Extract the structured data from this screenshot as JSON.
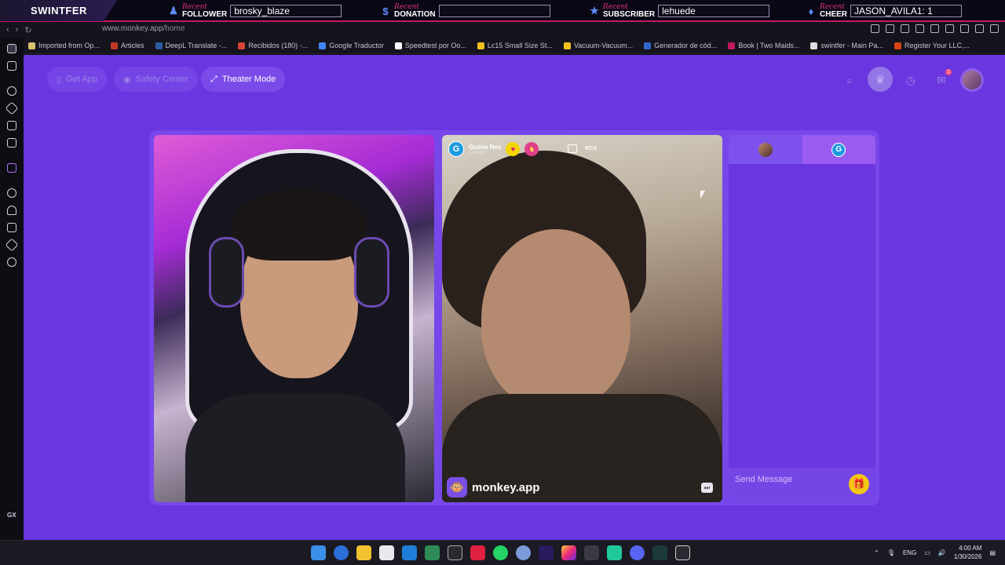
{
  "overlay": {
    "brand": "SWINTFER",
    "recent_label": "Recent",
    "follower": {
      "kind": "FOLLOWER",
      "value": "brosky_blaze",
      "icon": "person-icon"
    },
    "donation": {
      "kind": "DONATION",
      "value": "",
      "icon": "dollar-icon"
    },
    "subscriber": {
      "kind": "SUBSCRIBER",
      "value": "lehuede",
      "icon": "star-icon"
    },
    "cheer": {
      "kind": "CHEER",
      "value": "JASON_AVILA1: 1",
      "icon": "drop-icon"
    }
  },
  "browser": {
    "url_host": "www.monkey.app",
    "url_path": "/home",
    "bookmarks": [
      {
        "label": "Imported from Op...",
        "color": "#d9c06a"
      },
      {
        "label": "Articles",
        "color": "#c0392b"
      },
      {
        "label": "DeepL Translate -...",
        "color": "#2e5c9e"
      },
      {
        "label": "Recibidos (180) -...",
        "color": "#d44638"
      },
      {
        "label": "Google Traductor",
        "color": "#4285f4"
      },
      {
        "label": "Speedtest por Oo...",
        "color": "#ffffff"
      },
      {
        "label": "Lc15 Small Size St...",
        "color": "#f0c020"
      },
      {
        "label": "Vacuum-Vacuum...",
        "color": "#f0c020"
      },
      {
        "label": "Generador de cód...",
        "color": "#3366cc"
      },
      {
        "label": "Book | Two Maids...",
        "color": "#c2185b"
      },
      {
        "label": "swintfer - Main Pa...",
        "color": "#dddddd"
      },
      {
        "label": "Register Your LLC,...",
        "color": "#d84315"
      }
    ],
    "gx_label": "GX"
  },
  "app": {
    "get_app": "Get App",
    "safety_center": "Safety Center",
    "theater_mode": "Theater Mode",
    "peer": {
      "initial": "G",
      "name": "Gueva Nea",
      "location": "Canadá",
      "tag": "RGX"
    },
    "watermark": "monkey.app",
    "chat_tab_b_initial": "G",
    "message_placeholder": "Send Message",
    "notification_count": "1"
  },
  "taskbar": {
    "lang": "ENG",
    "time": "4:00 AM",
    "date": "1/30/2026"
  },
  "colors": {
    "page_bg": "#6a36e0",
    "accent_pink": "#c21a6a",
    "gift": "#f3c712"
  }
}
